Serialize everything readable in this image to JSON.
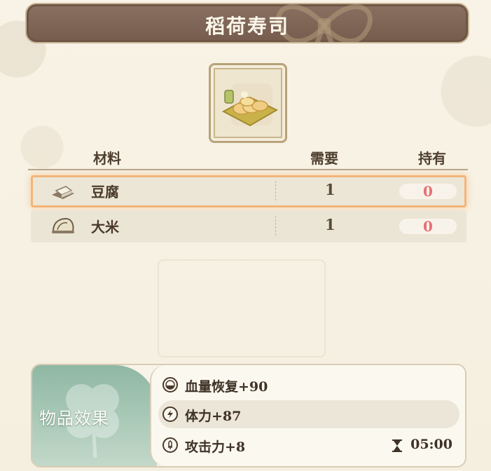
{
  "title": "稻荷寿司",
  "item": {
    "name_icon": "inari-sushi-plate-icon"
  },
  "table": {
    "headers": {
      "material": "材料",
      "need": "需要",
      "have": "持有"
    },
    "rows": [
      {
        "icon": "tofu-icon",
        "name": "豆腐",
        "need": "1",
        "have": "0",
        "selected": true
      },
      {
        "icon": "rice-sack-icon",
        "name": "大米",
        "need": "1",
        "have": "0",
        "selected": false
      }
    ]
  },
  "effects": {
    "title": "物品效果",
    "items": [
      {
        "icon": "hp-recovery-icon",
        "text": "血量恢复+90"
      },
      {
        "icon": "stamina-bolt-icon",
        "text": "体力+87"
      },
      {
        "icon": "attack-sword-icon",
        "text": "攻击力+8",
        "duration": "05:00"
      }
    ]
  },
  "colors": {
    "banner": "#7d6454",
    "have_zero": "#e76f72",
    "selected_glow": "#f1b57a",
    "effects_green": "#a8c8b6"
  }
}
